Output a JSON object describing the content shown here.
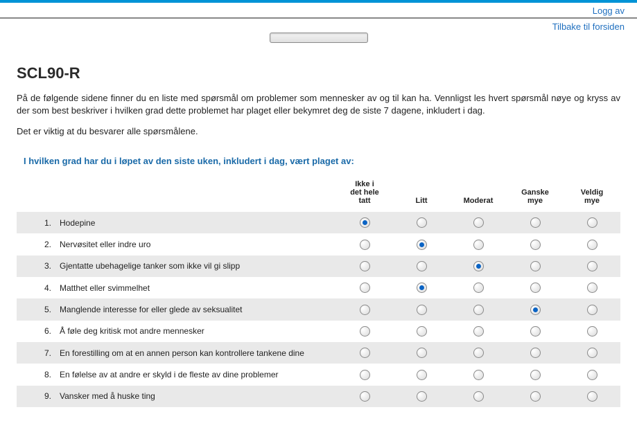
{
  "header": {
    "logoff": "Logg av",
    "back_link": "Tilbake til forsiden"
  },
  "page": {
    "title": "SCL90-R",
    "intro": "På de følgende sidene finner du en liste med spørsmål om problemer som mennesker av og til kan ha. Vennligst les hvert spørsmål nøye og kryss av der som best beskriver i hvilken grad dette problemet har plaget eller bekymret deg de siste 7 dagene, inkludert i dag.",
    "note": "Det er viktig at du besvarer alle spørsmålene.",
    "section_title": "I hvilken grad har du i løpet av den siste uken, inkludert i dag, vært plaget av:"
  },
  "options": [
    "Ikke i\ndet hele\ntatt",
    "Litt",
    "Moderat",
    "Ganske\nmye",
    "Veldig\nmye"
  ],
  "questions": [
    {
      "n": "1.",
      "text": "Hodepine",
      "selected": 0
    },
    {
      "n": "2.",
      "text": "Nervøsitet eller indre uro",
      "selected": 1
    },
    {
      "n": "3.",
      "text": "Gjentatte ubehagelige tanker som ikke vil gi slipp",
      "selected": 2
    },
    {
      "n": "4.",
      "text": "Matthet eller svimmelhet",
      "selected": 1
    },
    {
      "n": "5.",
      "text": "Manglende interesse for eller glede av seksualitet",
      "selected": 3
    },
    {
      "n": "6.",
      "text": "Å føle deg kritisk mot andre mennesker",
      "selected": null
    },
    {
      "n": "7.",
      "text": "En forestilling om at en annen person kan kontrollere tankene dine",
      "selected": null
    },
    {
      "n": "8.",
      "text": "En følelse av at andre er skyld i de fleste av dine problemer",
      "selected": null
    },
    {
      "n": "9.",
      "text": "Vansker med å huske ting",
      "selected": null
    }
  ]
}
